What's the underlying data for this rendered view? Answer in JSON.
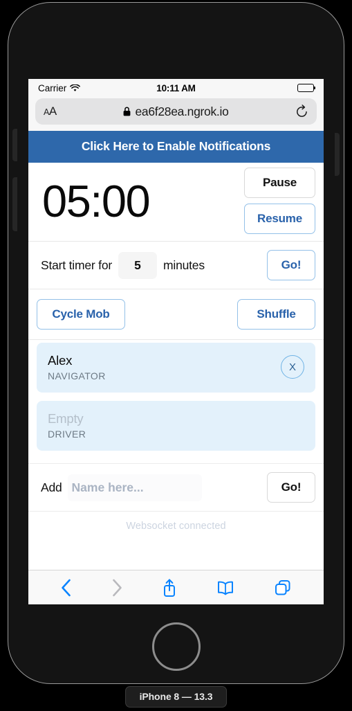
{
  "device": {
    "label": "iPhone 8 — 13.3",
    "home_button": "home-button",
    "volume_up": "volume-up-button",
    "volume_down": "volume-down-button",
    "power": "power-button"
  },
  "status_bar": {
    "carrier": "Carrier",
    "wifi_icon": "wifi-icon",
    "time": "10:11 AM",
    "battery_icon": "battery-icon"
  },
  "browser": {
    "text_size_label_small": "A",
    "text_size_label_large": "A",
    "lock_icon": "lock-icon",
    "url": "ea6f28ea.ngrok.io",
    "reload_icon": "reload-icon",
    "toolbar": {
      "back_icon": "back-chevron-icon",
      "forward_icon": "forward-chevron-icon",
      "share_icon": "share-icon",
      "bookmarks_icon": "book-icon",
      "tabs_icon": "tabs-icon"
    }
  },
  "page": {
    "notification_banner": "Click Here to Enable Notifications",
    "timer": {
      "display": "05:00",
      "pause_label": "Pause",
      "resume_label": "Resume"
    },
    "start_timer": {
      "label": "Start timer for",
      "minutes_value": "5",
      "minutes_placeholder": "5",
      "unit_label": "minutes",
      "go_label": "Go!"
    },
    "mob_actions": {
      "cycle_label": "Cycle Mob",
      "shuffle_label": "Shuffle"
    },
    "members": [
      {
        "name": "Alex",
        "role": "NAVIGATOR",
        "empty": false,
        "remove_label": "X"
      },
      {
        "name": "Empty",
        "role": "DRIVER",
        "empty": true,
        "remove_label": ""
      }
    ],
    "add_member": {
      "label": "Add",
      "input_value": "",
      "input_placeholder": "Name here...",
      "go_label": "Go!"
    },
    "status_message": "Websocket connected"
  },
  "colors": {
    "banner_blue": "#2e68ab",
    "accent_blue": "#2962ab",
    "card_blue": "#e3f1fb",
    "safari_icon_blue": "#0a84ff"
  }
}
